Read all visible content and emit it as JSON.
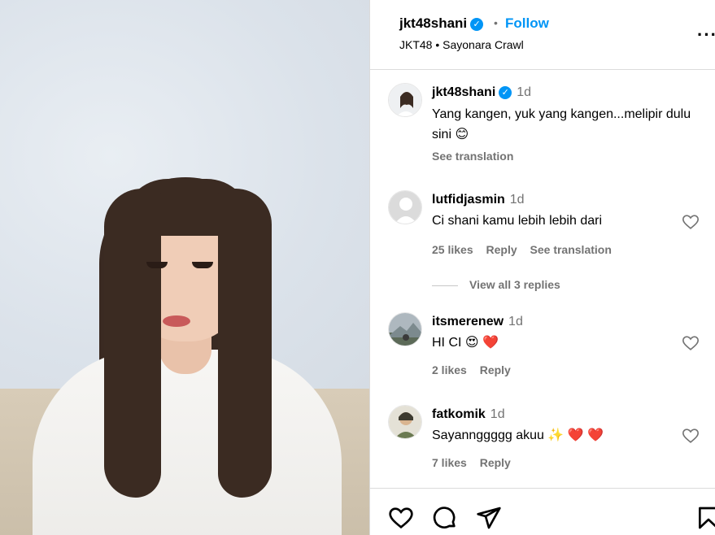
{
  "post": {
    "username": "jkt48shani",
    "follow_label": "Follow",
    "separator": "•",
    "subtitle": "JKT48 • Sayonara Crawl",
    "more_icon": "more-horizontal-icon"
  },
  "caption": {
    "username": "jkt48shani",
    "time": "1d",
    "text": "Yang kangen, yuk yang kangen...melipir dulu sini 😊",
    "see_translation": "See translation"
  },
  "comments": [
    {
      "username": "lutfidjasmin",
      "time": "1d",
      "text": "Ci shani kamu lebih lebih dari",
      "likes": "25 likes",
      "reply": "Reply",
      "see_translation": "See translation",
      "view_replies": "View all 3 replies"
    },
    {
      "username": "itsmerenew",
      "time": "1d",
      "text": "HI CI 😍 ❤️",
      "likes": "2 likes",
      "reply": "Reply"
    },
    {
      "username": "fatkomik",
      "time": "1d",
      "text": "Sayannggggg akuu ✨ ❤️ ❤️",
      "likes": "7 likes",
      "reply": "Reply"
    }
  ],
  "colors": {
    "accent": "#0095f6",
    "muted": "#737373",
    "heart_red": "#e0162b"
  }
}
